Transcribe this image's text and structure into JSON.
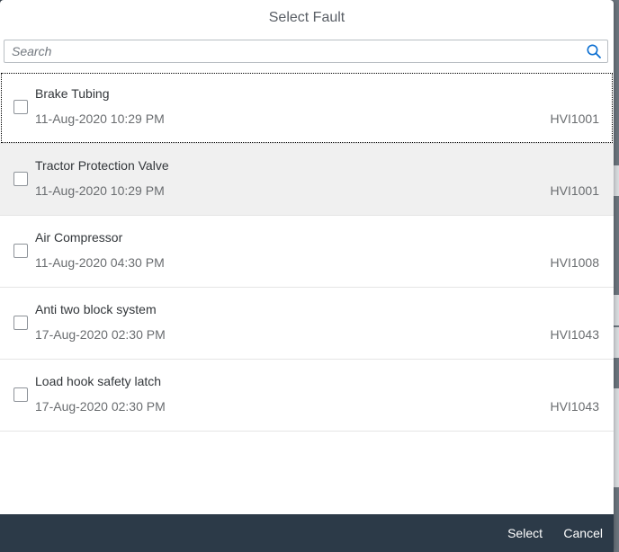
{
  "dialog": {
    "title": "Select Fault"
  },
  "search": {
    "placeholder": "Search",
    "value": ""
  },
  "faults": [
    {
      "title": "Brake Tubing",
      "date": "11-Aug-2020 10:29 PM",
      "code": "HVI1001"
    },
    {
      "title": "Tractor Protection Valve",
      "date": "11-Aug-2020 10:29 PM",
      "code": "HVI1001"
    },
    {
      "title": "Air Compressor",
      "date": "11-Aug-2020 04:30 PM",
      "code": "HVI1008"
    },
    {
      "title": "Anti two block system",
      "date": "17-Aug-2020 02:30 PM",
      "code": "HVI1043"
    },
    {
      "title": "Load hook safety latch",
      "date": "17-Aug-2020 02:30 PM",
      "code": "HVI1043"
    }
  ],
  "footer": {
    "select_label": "Select",
    "cancel_label": "Cancel"
  },
  "colors": {
    "footer_bg": "#2c3a48",
    "hover_row": "#f0f0f0"
  }
}
